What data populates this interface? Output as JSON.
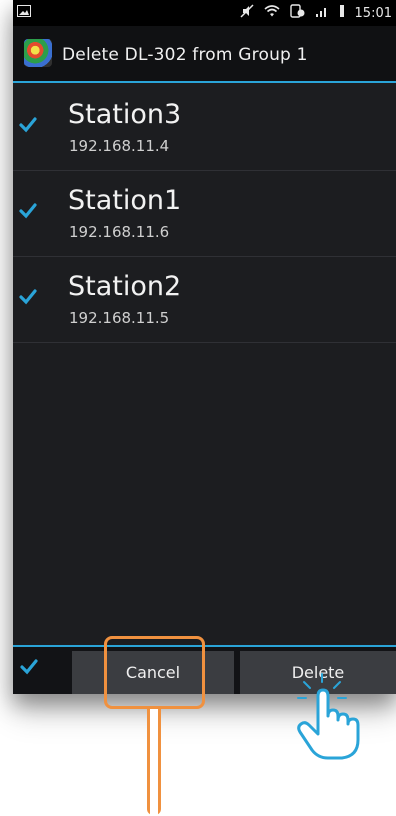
{
  "status_bar": {
    "time": "15:01",
    "icons": [
      "gallery-icon",
      "mute-icon",
      "wifi-icon",
      "nfc-icon",
      "signal-icon",
      "battery-icon"
    ]
  },
  "dialog": {
    "title": "Delete DL-302 from Group 1",
    "app_icon": "app-icon"
  },
  "stations": [
    {
      "name": "Station3",
      "ip": "192.168.11.4",
      "checked": true
    },
    {
      "name": "Station1",
      "ip": "192.168.11.6",
      "checked": true
    },
    {
      "name": "Station2",
      "ip": "192.168.11.5",
      "checked": true
    }
  ],
  "bottom_bar": {
    "select_all_checked": true,
    "cancel_label": "Cancel",
    "delete_label": "Delete"
  },
  "colors": {
    "accent": "#2aa4d8",
    "highlight": "#f0913f",
    "background": "#1c1d20"
  }
}
